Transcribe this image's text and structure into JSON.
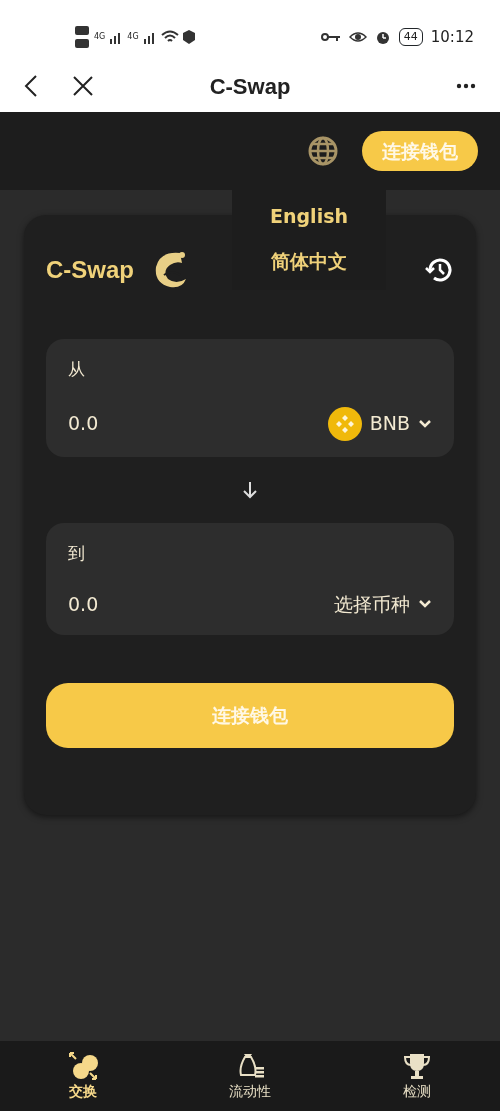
{
  "status_bar": {
    "time": "10:12",
    "battery": "44",
    "network": [
      "4G",
      "4G"
    ]
  },
  "header": {
    "title": "C-Swap"
  },
  "top_bar": {
    "connect_button": "连接钱包"
  },
  "language_menu": {
    "options": [
      "English",
      "简体中文"
    ]
  },
  "swap_card": {
    "brand": "C-Swap",
    "from": {
      "label": "从",
      "amount": "0.0",
      "token": "BNB",
      "kind": "token"
    },
    "to": {
      "label": "到",
      "amount": "0.0",
      "token": "选择币种",
      "kind": "select"
    },
    "connect_button": "连接钱包"
  },
  "bottom_nav": [
    {
      "label": "交换",
      "selected": true
    },
    {
      "label": "流动性",
      "selected": false
    },
    {
      "label": "检测",
      "selected": false
    }
  ]
}
